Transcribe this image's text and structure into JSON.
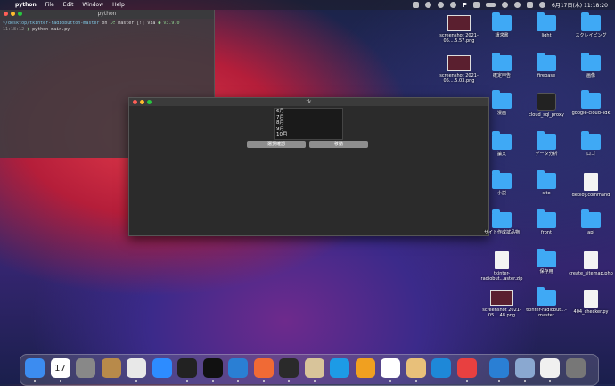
{
  "menubar": {
    "app_name": "python",
    "items": [
      "File",
      "Edit",
      "Window",
      "Help"
    ],
    "clock": "6月17日(木) 11:18:20"
  },
  "terminal": {
    "title": "python",
    "line1_path": "~/desktop/tkinter-radiobutton-master",
    "line1_on": " on ",
    "line1_branch": "master [!] via",
    "line1_ver": " v3.9.0",
    "line2_time": "11:18:12",
    "line2_cmd": " python main.py"
  },
  "tk_window": {
    "title": "tk",
    "list_items": [
      "6月",
      "7月",
      "8月",
      "9月",
      "10月"
    ],
    "btn_select": "選択確認",
    "btn_move": "移動"
  },
  "desktop": {
    "items": [
      {
        "label": "screenshot 2021-05....5.57.png",
        "kind": "shot"
      },
      {
        "label": "請求書",
        "kind": "folder"
      },
      {
        "label": "light",
        "kind": "folder"
      },
      {
        "label": "スクレイピング",
        "kind": "folder"
      },
      {
        "label": "screenshot 2021-05....5.03.png",
        "kind": "shot"
      },
      {
        "label": "確定申告",
        "kind": "folder"
      },
      {
        "label": "firebase",
        "kind": "folder"
      },
      {
        "label": "画像",
        "kind": "folder"
      },
      {
        "label": "漫画",
        "kind": "folder"
      },
      {
        "label": "cloud_sql_proxy",
        "kind": "black"
      },
      {
        "label": "google-cloud-sdk",
        "kind": "folder"
      },
      {
        "label": "論文",
        "kind": "folder"
      },
      {
        "label": "データ分析",
        "kind": "folder"
      },
      {
        "label": "ロゴ",
        "kind": "folder"
      },
      {
        "label": "小説",
        "kind": "folder"
      },
      {
        "label": "site",
        "kind": "folder"
      },
      {
        "label": "deploy.command",
        "kind": "doc"
      },
      {
        "label": "サイト作成試品物",
        "kind": "folder"
      },
      {
        "label": "front",
        "kind": "folder"
      },
      {
        "label": "api",
        "kind": "folder"
      },
      {
        "label": "tkinter-radiobut...aster.zip",
        "kind": "doc"
      },
      {
        "label": "保存用",
        "kind": "folder"
      },
      {
        "label": "create_sitemap.php",
        "kind": "doc"
      },
      {
        "label": "screenshot 2021-05....48.png",
        "kind": "shot"
      },
      {
        "label": "tkinter-radiobut...-master",
        "kind": "folder"
      },
      {
        "label": "404_checker.py",
        "kind": "doc"
      }
    ]
  },
  "dock": {
    "calendar_day": "17",
    "apps": [
      "finder-icon",
      "calendar-icon",
      "system-prefs-icon",
      "contacts-icon",
      "chrome-icon",
      "zoom-icon",
      "iterm-icon",
      "terminal-icon",
      "vscode-icon",
      "swift-icon",
      "quicktime-icon",
      "python-launcher-icon",
      "docker-icon",
      "sourcetree-icon",
      "cursor-icon",
      "preview-icon",
      "arduino-icon",
      "screen-time-icon",
      "vscode2-icon",
      "finder-window-icon",
      "document-icon",
      "trash-icon"
    ],
    "colors": [
      "#3c8cf0",
      "#ffffff",
      "#888888",
      "#b88a4a",
      "#e8e8e8",
      "#2d8cff",
      "#222222",
      "#111111",
      "#2a7fd4",
      "#f06a35",
      "#2a2a2a",
      "#d8c49a",
      "#1d9be6",
      "#f0a020",
      "#ffffff",
      "#e8c07a",
      "#1e88d8",
      "#e84040",
      "#2a7fd4",
      "#8aa8d0",
      "#f0f0f0",
      "#777777"
    ]
  }
}
